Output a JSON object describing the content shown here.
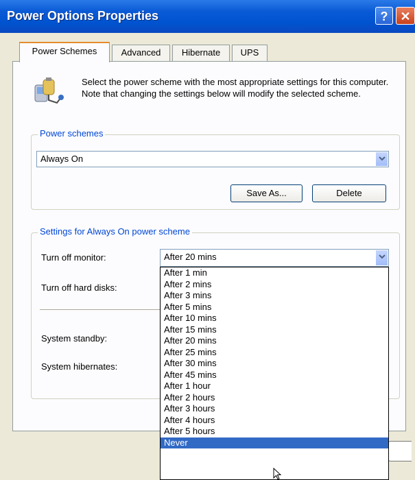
{
  "window": {
    "title": "Power Options Properties"
  },
  "tabs": [
    "Power Schemes",
    "Advanced",
    "Hibernate",
    "UPS"
  ],
  "description": "Select the power scheme with the most appropriate settings for this computer. Note that changing the settings below will modify the selected scheme.",
  "power_schemes": {
    "legend": "Power schemes",
    "selected": "Always On",
    "save_as_label": "Save As...",
    "delete_label": "Delete"
  },
  "settings": {
    "legend": "Settings for Always On power scheme",
    "turn_off_monitor_label": "Turn off monitor:",
    "turn_off_monitor_value": "After 20 mins",
    "turn_off_hard_disks_label": "Turn off hard disks:",
    "system_standby_label": "System standby:",
    "system_hibernates_label": "System hibernates:"
  },
  "dropdown_options": [
    "After 1 min",
    "After 2 mins",
    "After 3 mins",
    "After 5 mins",
    "After 10 mins",
    "After 15 mins",
    "After 20 mins",
    "After 25 mins",
    "After 30 mins",
    "After 45 mins",
    "After 1 hour",
    "After 2 hours",
    "After 3 hours",
    "After 4 hours",
    "After 5 hours",
    "Never"
  ],
  "dropdown_highlighted": "Never",
  "colors": {
    "title_blue": "#0053cf",
    "legend_blue": "#0046d5",
    "highlight": "#316ac5",
    "face": "#ece9d8"
  },
  "icons": [
    "help-icon",
    "close-icon",
    "power-scheme-icon",
    "chevron-down-icon",
    "mouse-cursor-icon"
  ]
}
